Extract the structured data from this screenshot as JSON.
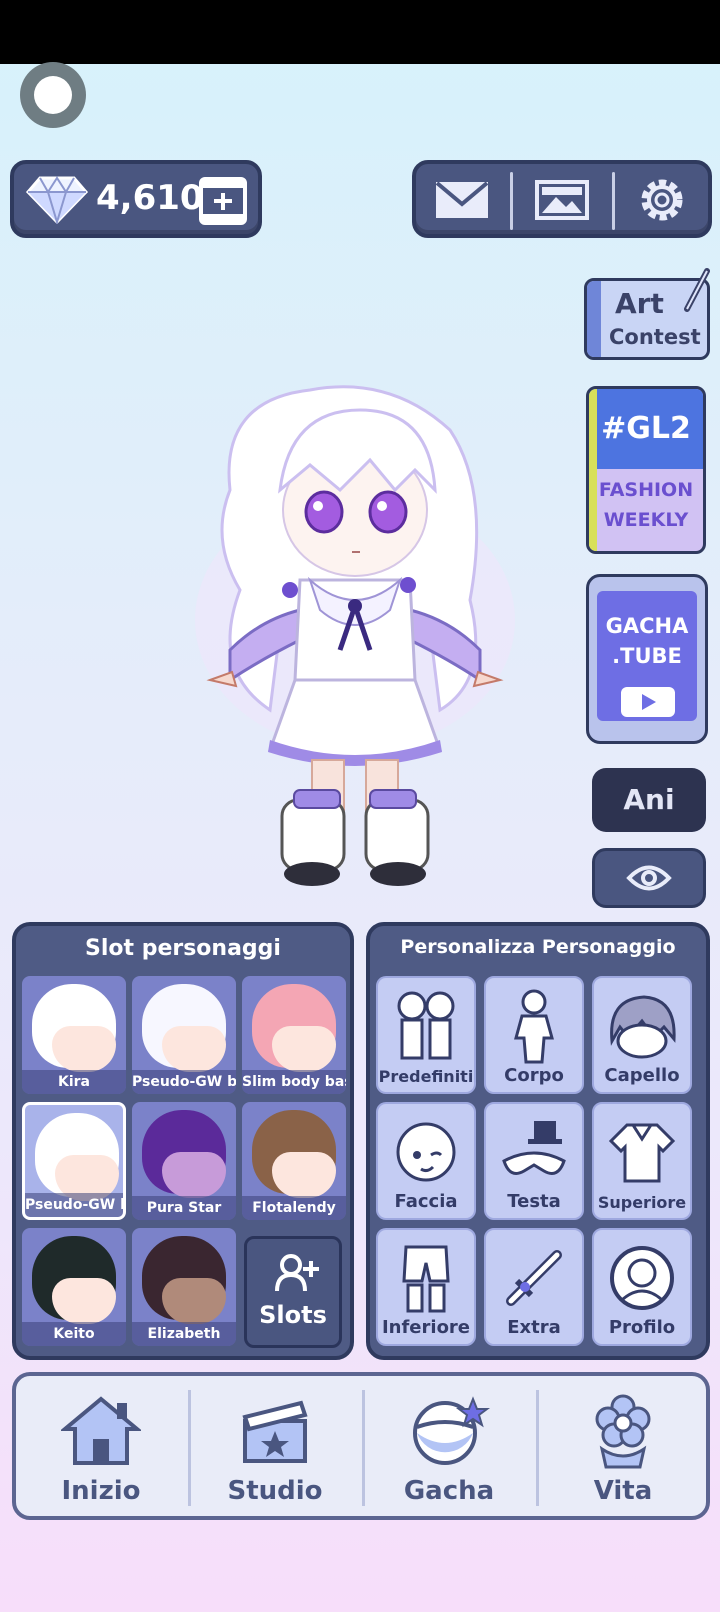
{
  "header": {
    "gems": "4,610"
  },
  "side_buttons": {
    "art_contest_line1": "Art",
    "art_contest_line2": "Contest",
    "gl2_title": "#GL2",
    "gl2_sub1": "FASHION",
    "gl2_sub2": "WEEKLY",
    "gachatube_line1": "GACHA",
    "gachatube_line2": ".TUBE",
    "ani": "Ani"
  },
  "slots_panel": {
    "title": "Slot personaggi",
    "slots": [
      {
        "label": "Kira"
      },
      {
        "label": "Pseudo-GW bas"
      },
      {
        "label": "Slim body bas"
      },
      {
        "label": "Pseudo-GW b"
      },
      {
        "label": "Pura Star"
      },
      {
        "label": "Flotalendy"
      },
      {
        "label": "Keito"
      },
      {
        "label": "Elizabeth"
      }
    ],
    "add_label": "Slots"
  },
  "customize_panel": {
    "title": "Personalizza Personaggio",
    "buttons": [
      {
        "label": "Predefiniti"
      },
      {
        "label": "Corpo"
      },
      {
        "label": "Capello"
      },
      {
        "label": "Faccia"
      },
      {
        "label": "Testa"
      },
      {
        "label": "Superiore"
      },
      {
        "label": "Inferiore"
      },
      {
        "label": "Extra"
      },
      {
        "label": "Profilo"
      }
    ]
  },
  "nav": {
    "items": [
      {
        "label": "Inizio",
        "icon": "house-icon"
      },
      {
        "label": "Studio",
        "icon": "clapperboard-icon"
      },
      {
        "label": "Gacha",
        "icon": "gacha-orb-icon"
      },
      {
        "label": "Vita",
        "icon": "flower-icon"
      }
    ]
  },
  "colors": {
    "panel": "#4f5b85",
    "panel_border": "#2f3a5e",
    "tile": "#c4ccf3",
    "accent": "#7b6cf0"
  }
}
